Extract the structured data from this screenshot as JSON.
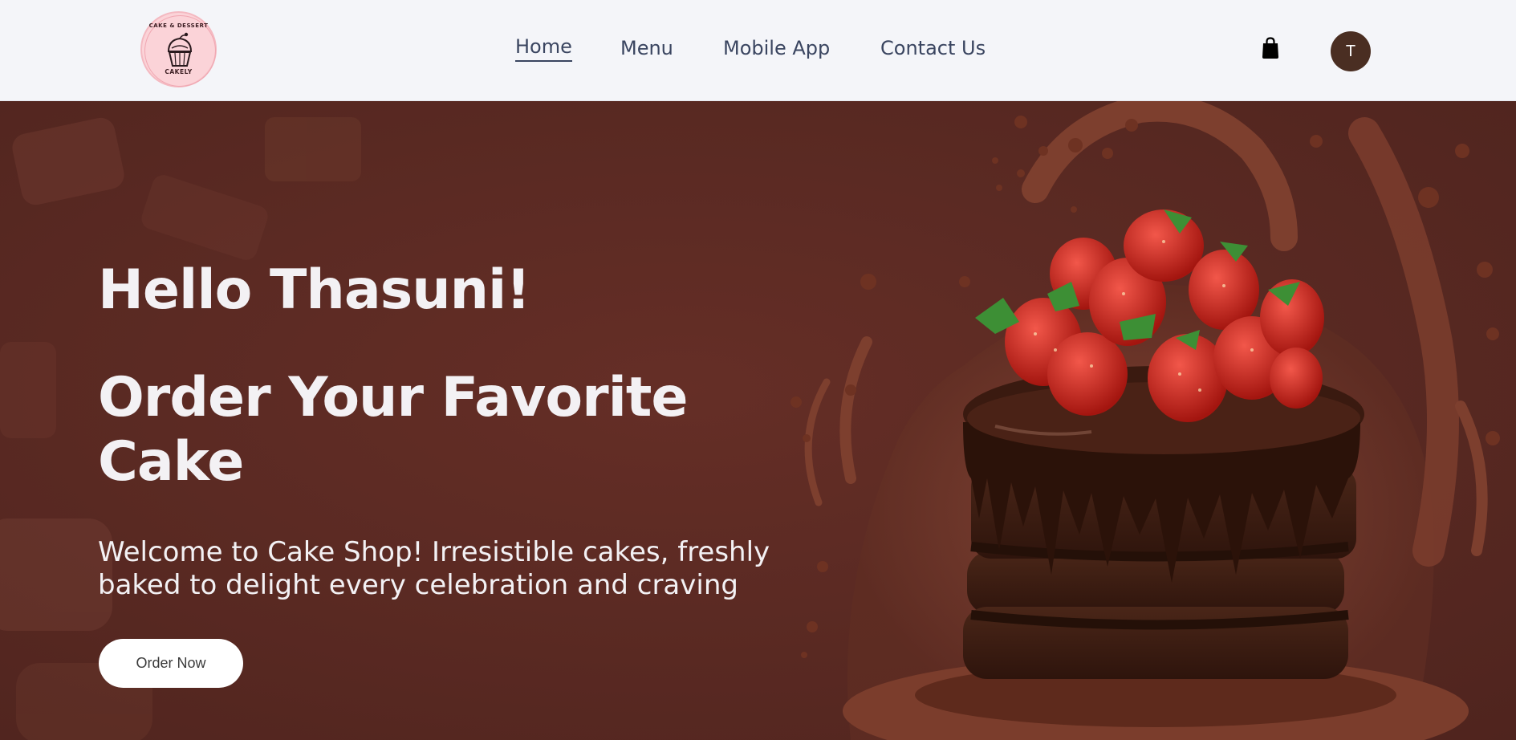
{
  "brand": {
    "logo_top_text": "CAKE & DESSERT",
    "logo_bottom_text": "CAKELY",
    "logo_bg_color": "#fbd3d8"
  },
  "nav": {
    "items": [
      {
        "label": "Home",
        "active": true
      },
      {
        "label": "Menu",
        "active": false
      },
      {
        "label": "Mobile App",
        "active": false
      },
      {
        "label": "Contact Us",
        "active": false
      }
    ],
    "cart_icon": "shopping-bag-icon",
    "avatar_initial": "T",
    "avatar_color": "#4a2e22"
  },
  "hero": {
    "greeting": "Hello Thasuni!",
    "headline": "Order Your Favorite Cake",
    "subtext": "Welcome to Cake Shop! Irresistible cakes, freshly baked to delight every celebration and craving",
    "cta_label": "Order Now",
    "image_subject": "chocolate-strawberry-cake",
    "background_color": "#5b2a23"
  }
}
